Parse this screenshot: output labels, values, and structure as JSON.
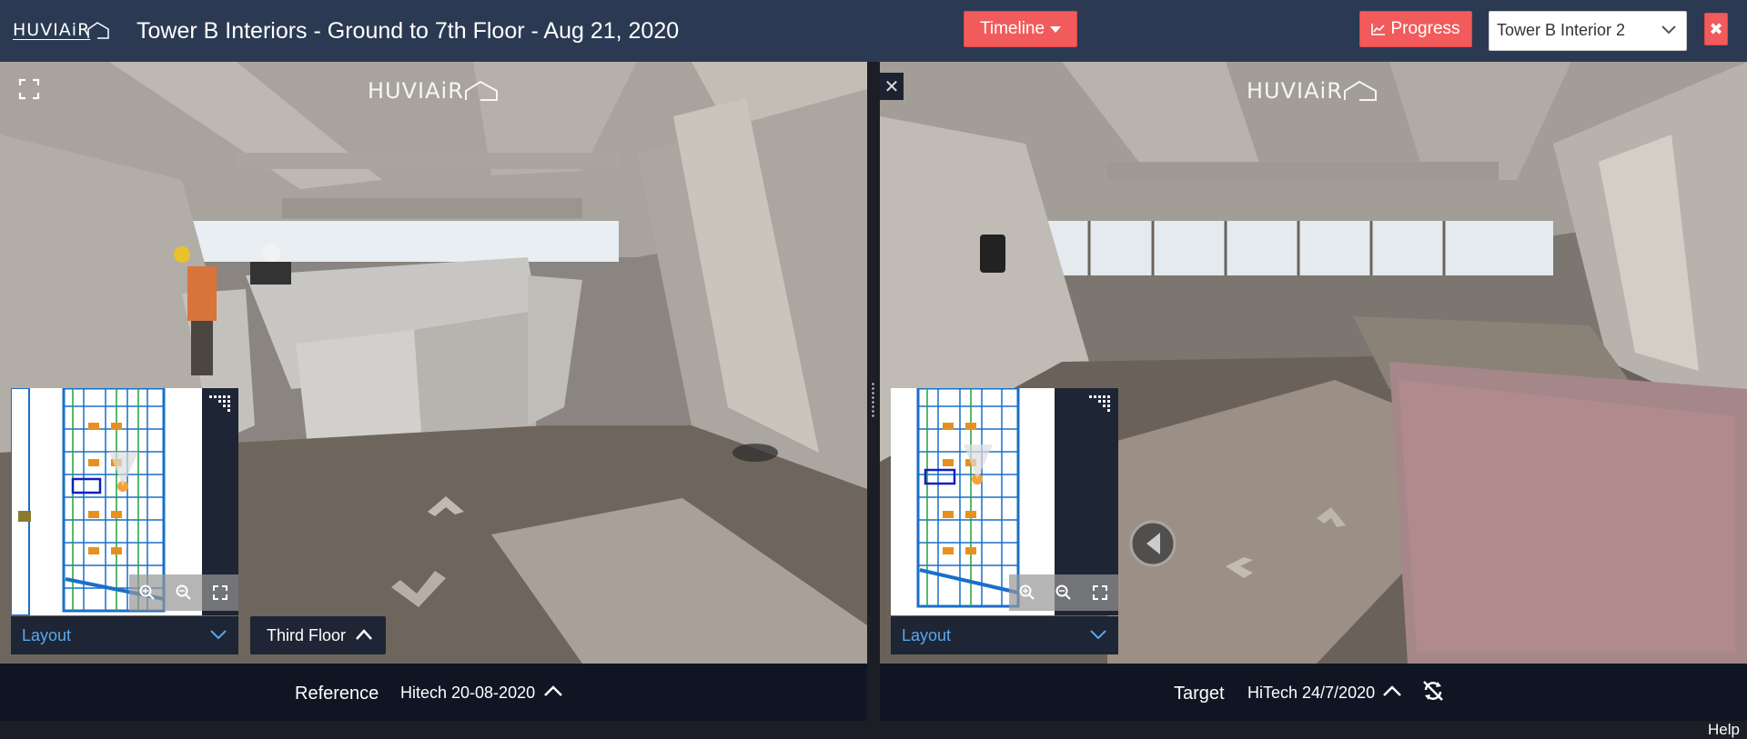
{
  "header": {
    "brand": "HUVIAiR",
    "title": "Tower B Interiors - Ground to 7th Floor - Aug 21, 2020",
    "timeline_label": "Timeline",
    "progress_label": "Progress",
    "project_select": "Tower B Interior 2",
    "close_label": "✖"
  },
  "left_panel": {
    "watermark": "HUVIAiR",
    "layout_label": "Layout",
    "floor_label": "Third Floor",
    "bottom": {
      "label": "Reference",
      "date": "Hitech 20-08-2020"
    }
  },
  "right_panel": {
    "watermark": "HUVIAiR",
    "close_label": "✕",
    "layout_label": "Layout",
    "bottom": {
      "label": "Target",
      "date": "HiTech 24/7/2020"
    }
  },
  "footer": {
    "help": "Help"
  },
  "colors": {
    "header_bg": "#2b3a52",
    "accent_red": "#f15b5b",
    "link_blue": "#5aa8ef"
  }
}
